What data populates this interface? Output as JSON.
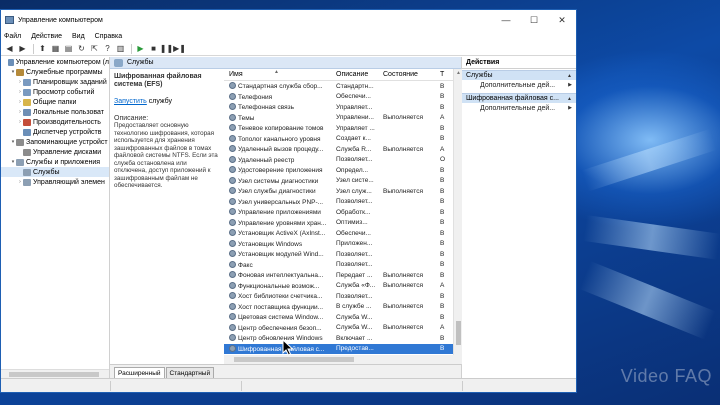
{
  "window": {
    "title": "Управление компьютером",
    "minimize": "—",
    "maximize": "☐",
    "close": "✕"
  },
  "menu": [
    "Файл",
    "Действие",
    "Вид",
    "Справка"
  ],
  "tree": [
    {
      "label": "Управление компьютером (л",
      "indent": 0,
      "twisty": "",
      "color": "#6b8fb8"
    },
    {
      "label": "Служебные программы",
      "indent": 1,
      "twisty": "▾",
      "color": "#b58a3a"
    },
    {
      "label": "Планировщик заданий",
      "indent": 2,
      "twisty": "›",
      "color": "#7a9ac0"
    },
    {
      "label": "Просмотр событий",
      "indent": 2,
      "twisty": "›",
      "color": "#7a9ac0"
    },
    {
      "label": "Общие папки",
      "indent": 2,
      "twisty": "›",
      "color": "#d8b54a"
    },
    {
      "label": "Локальные пользоват",
      "indent": 2,
      "twisty": "›",
      "color": "#6f8fb5"
    },
    {
      "label": "Производительность",
      "indent": 2,
      "twisty": "›",
      "color": "#c44e3a"
    },
    {
      "label": "Диспетчер устройств",
      "indent": 2,
      "twisty": "",
      "color": "#6b8fb8"
    },
    {
      "label": "Запоминающие устройст",
      "indent": 1,
      "twisty": "▾",
      "color": "#8c8c8c"
    },
    {
      "label": "Управление дисками",
      "indent": 2,
      "twisty": "",
      "color": "#8c8c8c"
    },
    {
      "label": "Службы и приложения",
      "indent": 1,
      "twisty": "▾",
      "color": "#8c9fb3"
    },
    {
      "label": "Службы",
      "indent": 2,
      "twisty": "",
      "color": "#8c9fb3",
      "selected": true
    },
    {
      "label": "Управляющий элемен",
      "indent": 2,
      "twisty": "›",
      "color": "#8c9fb3"
    }
  ],
  "center": {
    "header": "Службы",
    "desc_title": "Шифрованная файловая система (EFS)",
    "start_link": "Запустить",
    "start_suffix": " службу",
    "desc_label": "Описание:",
    "desc_text": "Предоставляет основную технологию шифрования, которая используется для хранения зашифрованных файлов в томах файловой системы NTFS. Если эта служба остановлена или отключена, доступ приложений к зашифрованным файлам не обеспечивается."
  },
  "list": {
    "columns": [
      "Имя",
      "Описание",
      "Состояние",
      "Т"
    ],
    "rows": [
      {
        "name": "Стандартная служба сбор...",
        "desc": "Стандартн...",
        "state": "",
        "type": "В"
      },
      {
        "name": "Телефония",
        "desc": "Обеспечи...",
        "state": "",
        "type": "В"
      },
      {
        "name": "Телефонная связь",
        "desc": "Управляет...",
        "state": "",
        "type": "В"
      },
      {
        "name": "Темы",
        "desc": "Управлени...",
        "state": "Выполняется",
        "type": "А"
      },
      {
        "name": "Теневое копирование томов",
        "desc": "Управляет ...",
        "state": "",
        "type": "В"
      },
      {
        "name": "Тополог канального уровня",
        "desc": "Создает к...",
        "state": "",
        "type": "В"
      },
      {
        "name": "Удаленный вызов процеду...",
        "desc": "Служба R...",
        "state": "Выполняется",
        "type": "А"
      },
      {
        "name": "Удаленный реестр",
        "desc": "Позволяет...",
        "state": "",
        "type": "О"
      },
      {
        "name": "Удостоверение приложения",
        "desc": "Определ...",
        "state": "",
        "type": "В"
      },
      {
        "name": "Узел системы диагностики",
        "desc": "Узел систе...",
        "state": "",
        "type": "В"
      },
      {
        "name": "Узел службы диагностики",
        "desc": "Узел служ...",
        "state": "Выполняется",
        "type": "В"
      },
      {
        "name": "Узел универсальных PNP-...",
        "desc": "Позволяет...",
        "state": "",
        "type": "В"
      },
      {
        "name": "Управление приложениями",
        "desc": "Обработк...",
        "state": "",
        "type": "В"
      },
      {
        "name": "Управление уровнями хран...",
        "desc": "Оптимиз...",
        "state": "",
        "type": "В"
      },
      {
        "name": "Установщик ActiveX (AxInst...",
        "desc": "Обеспечи...",
        "state": "",
        "type": "В"
      },
      {
        "name": "Установщик Windows",
        "desc": "Приложен...",
        "state": "",
        "type": "В"
      },
      {
        "name": "Установщик модулей Wind...",
        "desc": "Позволяет...",
        "state": "",
        "type": "В"
      },
      {
        "name": "Факс",
        "desc": "Позволяет...",
        "state": "",
        "type": "В"
      },
      {
        "name": "Фоновая интеллектуальна...",
        "desc": "Передает ...",
        "state": "Выполняется",
        "type": "В"
      },
      {
        "name": "Функциональные возмож...",
        "desc": "Служба «Ф...",
        "state": "Выполняется",
        "type": "А"
      },
      {
        "name": "Хост библиотеки счетчика...",
        "desc": "Позволяет...",
        "state": "",
        "type": "В"
      },
      {
        "name": "Хост поставщика функции...",
        "desc": "В службе ...",
        "state": "Выполняется",
        "type": "В"
      },
      {
        "name": "Цветовая система Window...",
        "desc": "Служба W...",
        "state": "",
        "type": "В"
      },
      {
        "name": "Центр обеспечения безоп...",
        "desc": "Служба W...",
        "state": "Выполняется",
        "type": "А"
      },
      {
        "name": "Центр обновления Windows",
        "desc": "Включает ...",
        "state": "",
        "type": "В"
      },
      {
        "name": "Шифрованная файловая с...",
        "desc": "Предостав...",
        "state": "",
        "type": "В",
        "selected": true
      }
    ]
  },
  "tabs": [
    "Расширенный",
    "Стандартный"
  ],
  "actions": {
    "header": "Действия",
    "sections": [
      {
        "title": "Службы",
        "item": "Дополнительные дей..."
      },
      {
        "title": "Шифрованная файловая с...",
        "item": "Дополнительные дей..."
      }
    ]
  },
  "watermark": "Video FAQ"
}
